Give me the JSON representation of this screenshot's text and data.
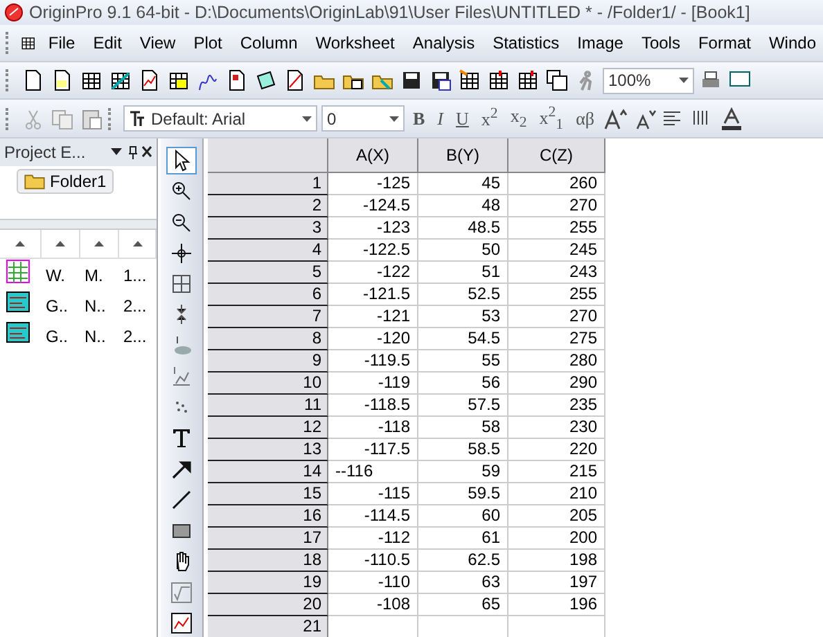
{
  "window": {
    "title": "OriginPro 9.1 64-bit - D:\\Documents\\OriginLab\\91\\User Files\\UNTITLED * - /Folder1/ - [Book1]"
  },
  "menu": [
    "File",
    "Edit",
    "View",
    "Plot",
    "Column",
    "Worksheet",
    "Analysis",
    "Statistics",
    "Image",
    "Tools",
    "Format",
    "Windo"
  ],
  "standard_toolbar": {
    "zoom": "100%"
  },
  "format_toolbar": {
    "font": "Default: Arial",
    "size": "0",
    "text_buttons": [
      {
        "kind": "bold",
        "label": "B"
      },
      {
        "kind": "italic",
        "label": "I"
      },
      {
        "kind": "underline",
        "label": "U"
      },
      {
        "kind": "plain",
        "label": "x$^{2}$"
      },
      {
        "kind": "plain",
        "label": "x$_{2}$"
      },
      {
        "kind": "plain",
        "label": "x$^{2}$$_{1}$"
      },
      {
        "kind": "plain",
        "label": "αβ"
      }
    ]
  },
  "project_explorer": {
    "title": "Project E...",
    "folder": "Folder1",
    "rows": [
      {
        "kind": "workbook",
        "cells": [
          "W.",
          "M.",
          "1..."
        ]
      },
      {
        "kind": "graph",
        "cells": [
          "G..",
          "N..",
          "2..."
        ]
      },
      {
        "kind": "graph",
        "cells": [
          "G..",
          "N..",
          "2..."
        ]
      }
    ]
  },
  "tools": [
    {
      "kind": "pointer",
      "selected": true
    },
    {
      "kind": "zoom-in",
      "selected": false
    },
    {
      "kind": "zoom-out",
      "selected": false
    },
    {
      "kind": "crosshair",
      "selected": false
    },
    {
      "kind": "region",
      "selected": false
    },
    {
      "kind": "pin",
      "selected": false
    },
    {
      "kind": "mask",
      "selected": false
    },
    {
      "kind": "regional-mask",
      "selected": false
    },
    {
      "kind": "dots",
      "selected": false
    },
    {
      "kind": "text",
      "selected": false
    },
    {
      "kind": "arrow",
      "selected": false
    },
    {
      "kind": "line",
      "selected": false
    },
    {
      "kind": "rect",
      "selected": false
    },
    {
      "kind": "hand",
      "selected": false
    },
    {
      "kind": "formula",
      "selected": false
    },
    {
      "kind": "graph",
      "selected": false
    }
  ],
  "table": {
    "columns": [
      "A(X)",
      "B(Y)",
      "C(Z)"
    ],
    "rows": [
      {
        "label": "1",
        "cells": [
          "-125",
          "45",
          "260"
        ]
      },
      {
        "label": "2",
        "cells": [
          "-124.5",
          "48",
          "270"
        ]
      },
      {
        "label": "3",
        "cells": [
          "-123",
          "48.5",
          "255"
        ]
      },
      {
        "label": "4",
        "cells": [
          "-122.5",
          "50",
          "245"
        ]
      },
      {
        "label": "5",
        "cells": [
          "-122",
          "51",
          "243"
        ]
      },
      {
        "label": "6",
        "cells": [
          "-121.5",
          "52.5",
          "255"
        ]
      },
      {
        "label": "7",
        "cells": [
          "-121",
          "53",
          "270"
        ]
      },
      {
        "label": "8",
        "cells": [
          "-120",
          "54.5",
          "275"
        ]
      },
      {
        "label": "9",
        "cells": [
          "-119.5",
          "55",
          "280"
        ]
      },
      {
        "label": "10",
        "cells": [
          "-119",
          "56",
          "290"
        ]
      },
      {
        "label": "11",
        "cells": [
          "-118.5",
          "57.5",
          "235"
        ]
      },
      {
        "label": "12",
        "cells": [
          "-118",
          "58",
          "230"
        ]
      },
      {
        "label": "13",
        "cells": [
          "-117.5",
          "58.5",
          "220"
        ]
      },
      {
        "label": "14",
        "editing": true,
        "cells": [
          "--116",
          "59",
          "215"
        ]
      },
      {
        "label": "15",
        "cells": [
          "-115",
          "59.5",
          "210"
        ]
      },
      {
        "label": "16",
        "cells": [
          "-114.5",
          "60",
          "205"
        ]
      },
      {
        "label": "17",
        "cells": [
          "-112",
          "61",
          "200"
        ]
      },
      {
        "label": "18",
        "cells": [
          "-110.5",
          "62.5",
          "198"
        ]
      },
      {
        "label": "19",
        "cells": [
          "-110",
          "63",
          "197"
        ]
      },
      {
        "label": "20",
        "cells": [
          "-108",
          "65",
          "196"
        ]
      },
      {
        "label": "21",
        "cells": [
          "",
          "",
          ""
        ]
      }
    ]
  }
}
